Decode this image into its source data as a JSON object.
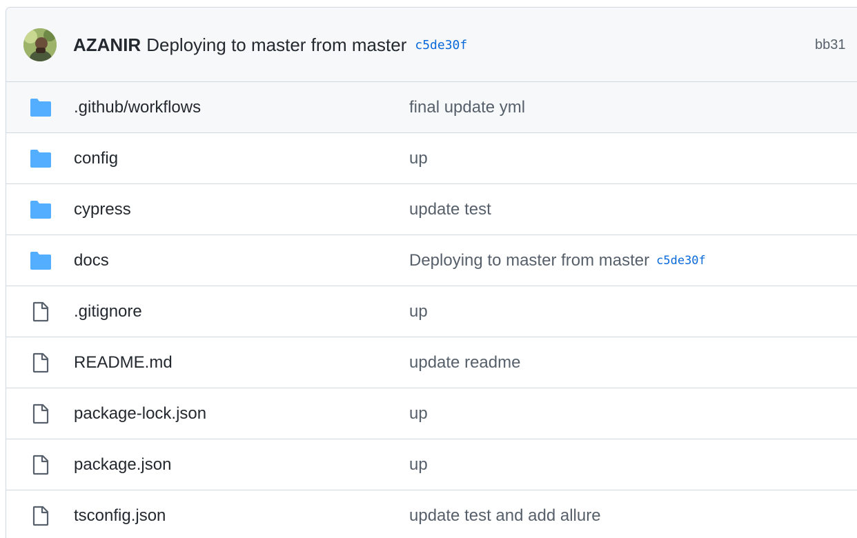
{
  "header": {
    "author": "AZANIR",
    "commit_message": "Deploying to master from master",
    "commit_sha": "c5de30f",
    "right_text": "bb31"
  },
  "files": [
    {
      "name": ".github/workflows",
      "type": "folder",
      "message": "final update yml",
      "sha": ""
    },
    {
      "name": "config",
      "type": "folder",
      "message": "up",
      "sha": ""
    },
    {
      "name": "cypress",
      "type": "folder",
      "message": "update test",
      "sha": ""
    },
    {
      "name": "docs",
      "type": "folder",
      "message": "Deploying to master from master",
      "sha": "c5de30f"
    },
    {
      "name": ".gitignore",
      "type": "file",
      "message": "up",
      "sha": ""
    },
    {
      "name": "README.md",
      "type": "file",
      "message": "update readme",
      "sha": ""
    },
    {
      "name": "package-lock.json",
      "type": "file",
      "message": "up",
      "sha": ""
    },
    {
      "name": "package.json",
      "type": "file",
      "message": "up",
      "sha": ""
    },
    {
      "name": "tsconfig.json",
      "type": "file",
      "message": "update test and add allure",
      "sha": ""
    }
  ],
  "colors": {
    "folder_icon": "#54aeff",
    "file_icon": "#57606a",
    "link": "#0969da"
  },
  "icons": {
    "folder": "folder-icon",
    "file": "file-icon"
  }
}
